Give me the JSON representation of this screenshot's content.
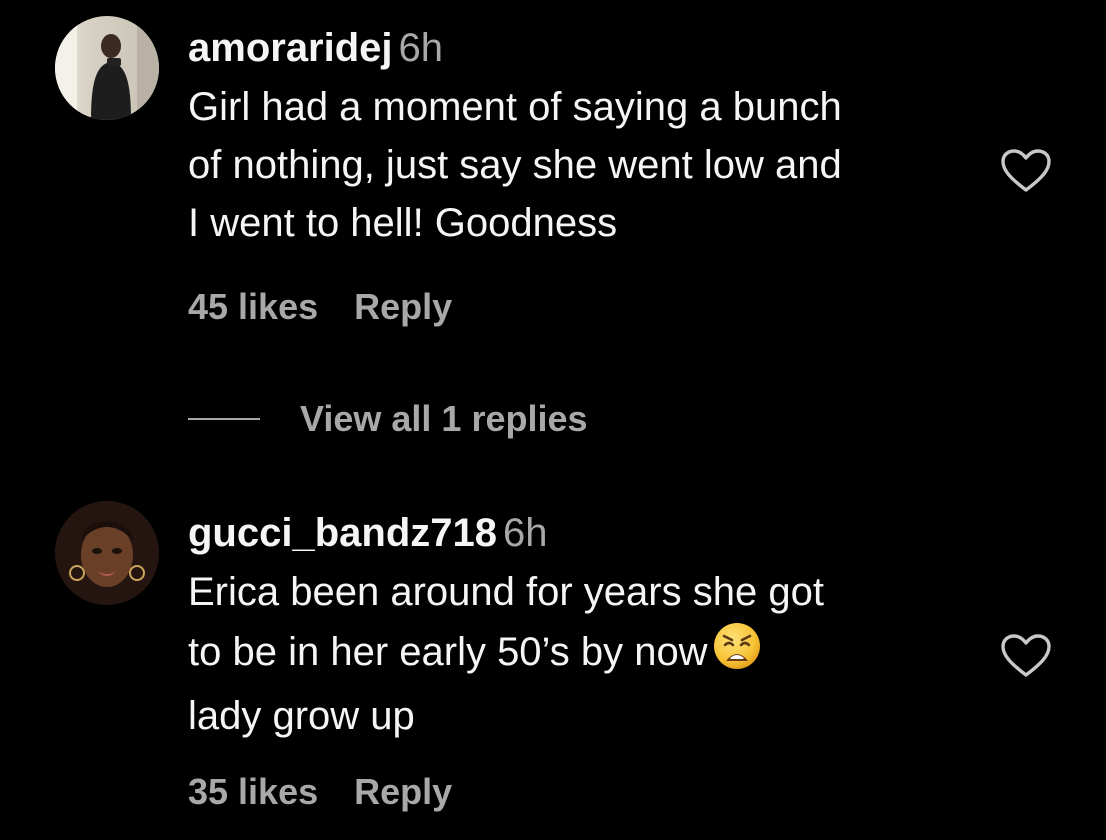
{
  "comments": [
    {
      "username": "amoraridej",
      "time": "6h",
      "lines": [
        "Girl had a moment of saying a bunch",
        "of nothing, just say she went low and",
        "I went to hell! Goodness"
      ],
      "likes": "45 likes",
      "reply_label": "Reply"
    },
    {
      "username": "gucci_bandz718",
      "time": "6h",
      "lines": [
        "Erica been around for years she got",
        "to be in her early 50’s by now",
        "lady grow up"
      ],
      "emoji": "weary-face",
      "likes": "35 likes",
      "reply_label": "Reply"
    }
  ],
  "view_replies_label": "View all 1 replies",
  "colors": {
    "background": "#000000",
    "text": "#f5f5f5",
    "secondary": "#a8a8a8"
  }
}
